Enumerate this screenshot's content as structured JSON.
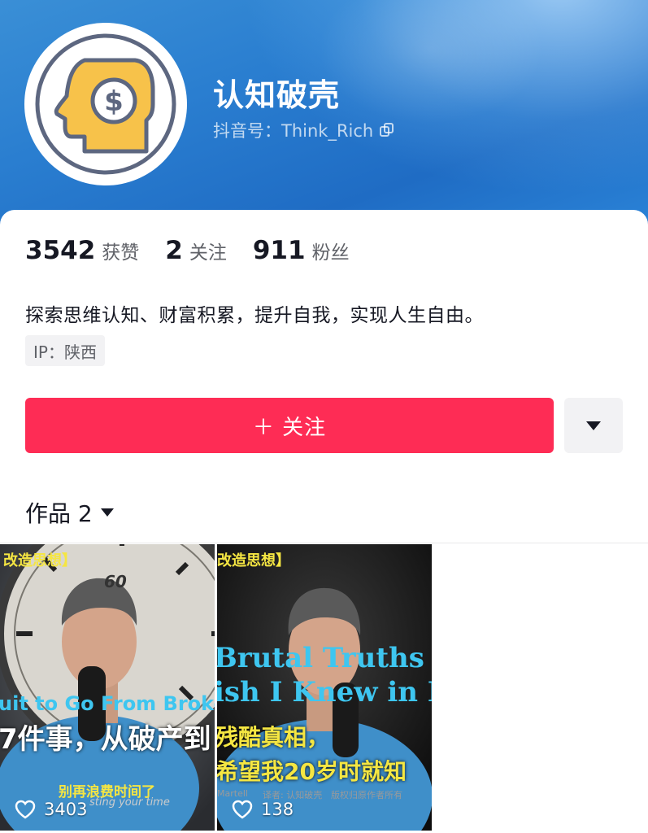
{
  "profile": {
    "nickname": "认知破壳",
    "account_label": "抖音号：Think_Rich",
    "avatar_icon": "head-dollar-icon",
    "copy_icon": "copy-icon"
  },
  "stats": [
    {
      "value": "3542",
      "label": "获赞"
    },
    {
      "value": "2",
      "label": "关注"
    },
    {
      "value": "911",
      "label": "粉丝"
    }
  ],
  "bio": "探索思维认知、财富积累，提升自我，实现人生自由。",
  "ip_tag": "IP：陕西",
  "actions": {
    "follow_label": "＋ 关注",
    "more_icon": "triangle-down-icon"
  },
  "works": {
    "tab_label": "作品 2",
    "items": [
      {
        "likes": "3403",
        "top_caption": "改造思想】",
        "english_caption": "uit to Go From Broke t",
        "chinese_caption": "7件事，从破产到",
        "sub_caption": "别再浪费时间了",
        "sub_caption_en": "sting your time",
        "clock_number": "60"
      },
      {
        "likes": "138",
        "top_caption": "改造思想】",
        "english_caption_1": "Brutal Truths",
        "english_caption_2": "ish I Knew in M",
        "chinese_caption_1": "残酷真相，",
        "chinese_caption_2": "希望我20岁时就知",
        "credit_1": "Martell",
        "credit_2": "译者: 认知破壳",
        "credit_3": "版权归原作者所有"
      }
    ]
  },
  "colors": {
    "accent": "#fe2c55",
    "header_blue": "#2a7ed0",
    "caption_yellow": "#f5e642",
    "caption_blue": "#3ec6f0"
  }
}
